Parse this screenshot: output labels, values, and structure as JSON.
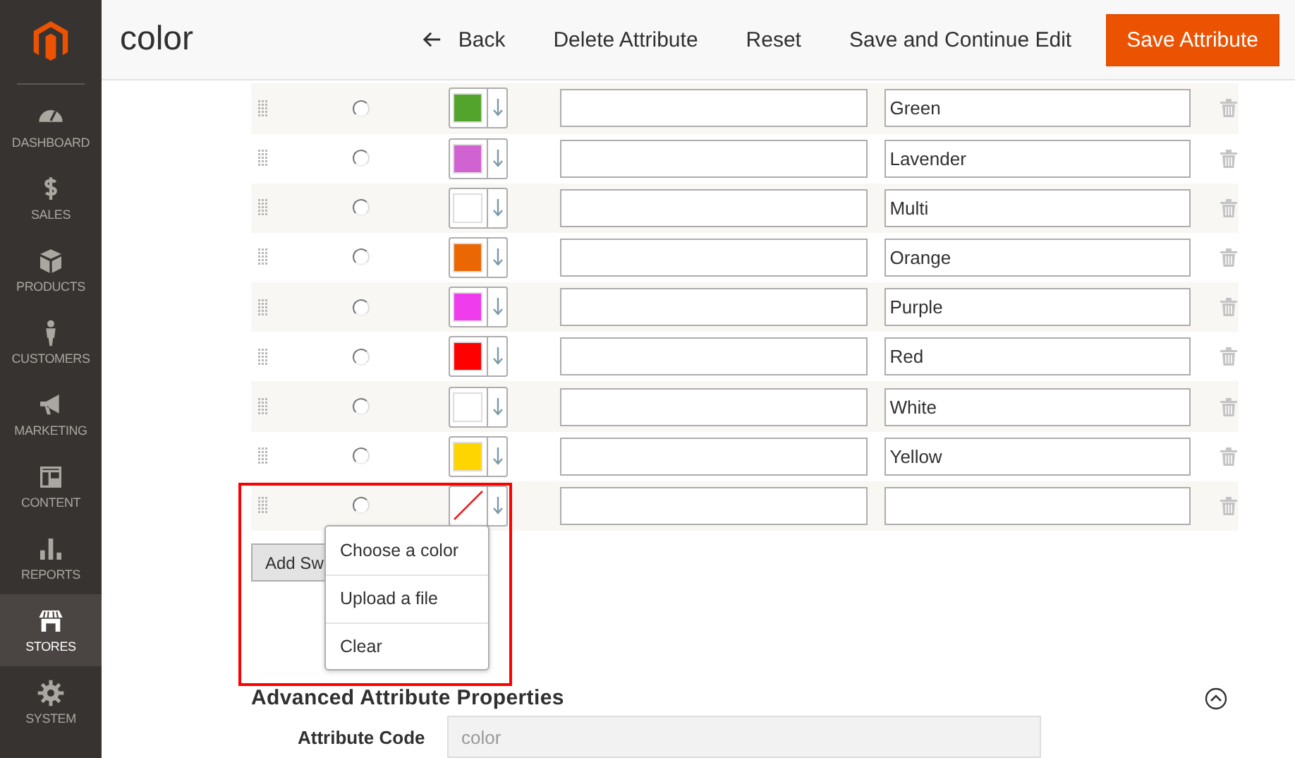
{
  "sidebar": {
    "items": [
      {
        "label": "DASHBOARD",
        "selected": false
      },
      {
        "label": "SALES",
        "selected": false
      },
      {
        "label": "PRODUCTS",
        "selected": false
      },
      {
        "label": "CUSTOMERS",
        "selected": false
      },
      {
        "label": "MARKETING",
        "selected": false
      },
      {
        "label": "CONTENT",
        "selected": false
      },
      {
        "label": "REPORTS",
        "selected": false
      },
      {
        "label": "STORES",
        "selected": true
      },
      {
        "label": "SYSTEM",
        "selected": false
      }
    ]
  },
  "header": {
    "title": "color",
    "actions": [
      {
        "label": "Back",
        "kind": "back"
      },
      {
        "label": "Delete Attribute",
        "kind": "link"
      },
      {
        "label": "Reset",
        "kind": "link"
      },
      {
        "label": "Save and Continue Edit",
        "kind": "link"
      },
      {
        "label": "Save Attribute",
        "kind": "primary"
      }
    ]
  },
  "swatches": [
    {
      "selected": false,
      "kind": "color",
      "color": "#53a42d",
      "store": "Green"
    },
    {
      "selected": false,
      "kind": "color",
      "color": "#d162d1",
      "store": "Lavender"
    },
    {
      "selected": false,
      "kind": "color",
      "color": "#ffffff",
      "store": "Multi"
    },
    {
      "selected": false,
      "kind": "color",
      "color": "#eb6703",
      "store": "Orange"
    },
    {
      "selected": false,
      "kind": "color",
      "color": "#ef3ded",
      "store": "Purple"
    },
    {
      "selected": false,
      "kind": "color",
      "color": "#ff0000",
      "store": "Red"
    },
    {
      "selected": false,
      "kind": "color",
      "color": "#ffffff",
      "store": "White"
    },
    {
      "selected": false,
      "kind": "color",
      "color": "#ffd500",
      "store": "Yellow"
    },
    {
      "selected": false,
      "kind": "none"
    }
  ],
  "add_button": {
    "label": "Add Sw"
  },
  "swatch_menu": {
    "items": [
      "Choose a color",
      "Upload a file",
      "Clear"
    ]
  },
  "advanced": {
    "title": "Advanced Attribute Properties",
    "expanded": true,
    "fields": [
      {
        "label": "Attribute Code",
        "value": "color",
        "disabled": true
      }
    ]
  }
}
